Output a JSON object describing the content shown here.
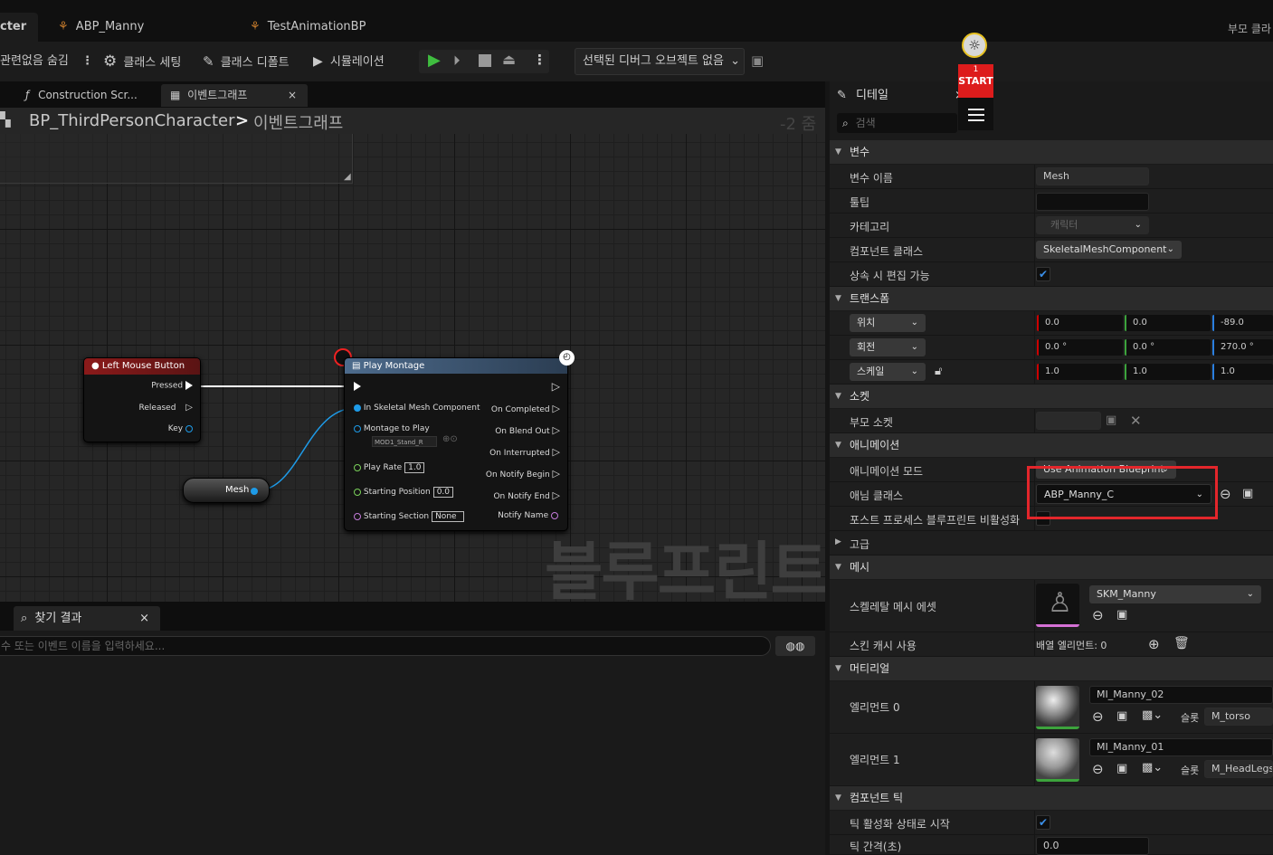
{
  "tabs": [
    {
      "label": "cter",
      "close": "×"
    },
    {
      "label": "ABP_Manny"
    },
    {
      "label": "TestAnimationBP"
    }
  ],
  "top_right_label": "부모 클라",
  "toolbar": {
    "hide_unrelated": "관련없음 숨김",
    "class_settings": "클래스 세팅",
    "class_defaults": "클래스 디폴트",
    "simulation": "시뮬레이션",
    "debug_object": "선택된 디버그 오브젝트 없음"
  },
  "overlay": {
    "start_number": "1",
    "start_label": "START"
  },
  "graph_tabs": [
    {
      "label": "Construction Scr...",
      "icon": "function-icon"
    },
    {
      "label": "이벤트그래프",
      "close": "×"
    }
  ],
  "breadcrumb": {
    "root": "BP_ThirdPersonCharacter",
    "separator": ">",
    "current": "이벤트그래프",
    "zoom": "-2 줌"
  },
  "watermark": "블루프린트",
  "nodes": {
    "left_mouse": {
      "title": "Left Mouse Button",
      "pins": [
        "Pressed",
        "Released",
        "Key"
      ]
    },
    "mesh": {
      "label": "Mesh"
    },
    "play_montage": {
      "title": "Play Montage",
      "inputs": [
        "In Skeletal Mesh Component",
        "Montage to Play",
        "Play Rate",
        "Starting Position",
        "Starting Section"
      ],
      "montage_value": "MOD1_Stand_R",
      "play_rate": "1.0",
      "starting_position": "0.0",
      "starting_section": "None",
      "outputs": [
        "On Completed",
        "On Blend Out",
        "On Interrupted",
        "On Notify Begin",
        "On Notify End",
        "Notify Name"
      ]
    }
  },
  "find_results": {
    "tab_label": "찾기 결과",
    "close": "×",
    "placeholder": "수 또는 이벤트 이름을 입력하세요..."
  },
  "details": {
    "tab_label": "디테일",
    "search_placeholder": "검색",
    "sections": {
      "variable": "변수",
      "transform": "트랜스폼",
      "socket": "소켓",
      "animation": "애니메이션",
      "advanced": "고급",
      "mesh": "메시",
      "material": "머티리얼",
      "component_tick": "컴포넌트 틱"
    },
    "variable": {
      "name_label": "변수 이름",
      "name_value": "Mesh",
      "tooltip_label": "툴팁",
      "tooltip_value": "",
      "category_label": "카테고리",
      "category_value": "캐릭터",
      "component_class_label": "컴포넌트 클래스",
      "component_class_value": "SkeletalMeshComponent",
      "editable_label": "상속 시 편집 가능",
      "editable_checked": true
    },
    "transform": {
      "location_label": "위치",
      "location": [
        "0.0",
        "0.0",
        "-89.0"
      ],
      "rotation_label": "회전",
      "rotation": [
        "0.0 °",
        "0.0 °",
        "270.0 °"
      ],
      "scale_label": "스케일",
      "scale": [
        "1.0",
        "1.0",
        "1.0"
      ]
    },
    "socket": {
      "parent_socket_label": "부모 소켓"
    },
    "animation": {
      "mode_label": "애니메이션 모드",
      "mode_value": "Use Animation Blueprint",
      "class_label": "애님 클래스",
      "class_value": "ABP_Manny_C",
      "post_process_label": "포스트 프로세스 블루프린트 비활성화"
    },
    "mesh": {
      "asset_label": "스켈레탈 메시 에셋",
      "asset_value": "SKM_Manny",
      "skin_cache_label": "스킨 캐시 사용",
      "array_elements": "배열 엘리먼트: 0"
    },
    "material": {
      "element0_label": "엘리먼트 0",
      "element0_value": "MI_Manny_02",
      "slot0_label": "슬롯",
      "slot0_value": "M_torso",
      "element1_label": "엘리먼트 1",
      "element1_value": "MI_Manny_01",
      "slot1_label": "슬롯",
      "slot1_value": "M_HeadLegs"
    },
    "tick": {
      "start_enabled_label": "틱 활성화 상태로 시작",
      "start_enabled_checked": true,
      "interval_label": "틱 간격(초)",
      "interval_value": "0.0"
    }
  },
  "colors": {
    "highlight": "#e3262b",
    "accent_blue": "#3b8fe8",
    "exec_wire": "#ffffff",
    "object_wire": "#1e9be8"
  }
}
